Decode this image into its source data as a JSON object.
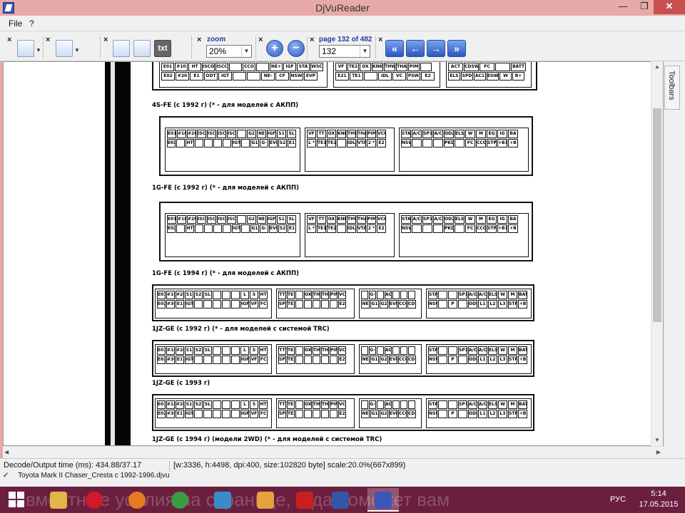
{
  "window": {
    "title": "DjVuReader",
    "minimize": "—",
    "maximize": "❐",
    "close": "✕"
  },
  "menu": {
    "file": "File",
    "help": "?"
  },
  "toolbar": {
    "zoom_label": "zoom",
    "zoom_value": "20%",
    "page_label": "page 132 of 482",
    "page_value": "132",
    "zoom_in": "+",
    "zoom_out": "−",
    "first": "«",
    "prev": "←",
    "next": "→",
    "last": "»",
    "close_mark": "×",
    "txt_label": "txt"
  },
  "side": {
    "toolbars_label": "Toolbars"
  },
  "document": {
    "captions": [
      "4S-FE (с 1992 г) (* - для моделей с АКПП)",
      "1G-FE (с 1992 г) (* - для моделей с АКПП)",
      "1G-FE (с 1994 г) (* - для моделей с АКПП)",
      "1JZ-GE (с 1992 г) (* - для моделей с системой TRC)",
      "1JZ-GE (с 1993 г)",
      "1JZ-GE (с 1994 г) (модели 2WD) (* - для моделей с системой TRC)"
    ],
    "connector_top_row": [
      [
        "E01",
        "#10",
        "HT",
        "ISCO",
        "ISCC",
        "",
        "CCO",
        "",
        "NE+",
        "IGF",
        "STA",
        "WSC"
      ],
      [
        "VF",
        "TE2",
        "OX",
        "KNK",
        "THW",
        "THA",
        "PIM",
        ""
      ],
      [
        "ACT",
        "CDSW",
        "FC",
        "",
        "BATT"
      ]
    ],
    "connector_top_row2": [
      [
        "E02",
        "#20",
        "E1",
        "ODT",
        "IGT",
        "",
        "",
        "NE-",
        "CF",
        "NSW",
        "EVP"
      ],
      [
        "E21",
        "TE1",
        "",
        "IDL",
        "VC",
        "PSW",
        "E2"
      ],
      [
        "ELS",
        "SPD",
        "AC1",
        "EGW",
        "W",
        "B+"
      ]
    ],
    "connectors_1g_a": [
      [
        "E01",
        "#10",
        "#20",
        "ISC 1",
        "ISC 2",
        "ISC 3",
        "ISC 4",
        "",
        "G2",
        "NE",
        "IGF",
        "S1 *",
        "SL *"
      ],
      [
        "E02",
        "",
        "HT",
        "",
        "",
        "",
        "",
        "IGT",
        "",
        "G1",
        "G-",
        "EVP",
        "S2 *",
        "E1"
      ],
      [
        "VF",
        "TT *",
        "OX",
        "KNK",
        "THW",
        "THA",
        "PIM",
        "VCC"
      ],
      [
        "L *",
        "TE1",
        "TE2",
        "",
        "IDL",
        "VTA",
        "2 *",
        "E2"
      ],
      [
        "STA",
        "A/C",
        "SP1",
        "A/C MG",
        "OD2 *",
        "ELS",
        "W",
        "M REL",
        "EG W",
        "IG SW",
        "BA TT"
      ],
      [
        "NSW *",
        "",
        "",
        "",
        "PKD *",
        "",
        "FC",
        "CCO",
        "STP",
        "+B1",
        "+B"
      ]
    ],
    "connectors_1jz": [
      [
        "E01",
        "#10",
        "#20",
        "S1",
        "S2",
        "SL",
        "",
        "",
        "",
        "L",
        "S",
        "HT"
      ],
      [
        "E02",
        "#30",
        "E1",
        "IGT",
        "",
        "",
        "",
        "",
        "",
        "IGF",
        "VF",
        "FC"
      ],
      [
        "TT",
        "TE1",
        "",
        "OX",
        "THA",
        "THW",
        "PIM",
        "VCC"
      ],
      [
        "SP2",
        "TE2",
        "",
        "",
        "",
        "",
        "",
        "E2"
      ],
      [
        "",
        "G-",
        "",
        "ACV",
        "",
        "",
        ""
      ],
      [
        "NE",
        "G1",
        "G2",
        "EVP",
        "CCO",
        "CDS"
      ],
      [
        "STA",
        "",
        "",
        "SP1",
        "A/C",
        "A/C",
        "ELS",
        "W",
        "M",
        "BATT"
      ],
      [
        "NSW",
        "",
        "P",
        "",
        "ODI",
        "L1",
        "L2",
        "L3",
        "STP",
        "+B"
      ]
    ]
  },
  "status": {
    "decode_time": "Decode/Output time (ms): 434.88/37.17",
    "page_info": "[w:3336, h:4498, dpi:400, size:102820 byte] scale:20.0%(667x899)",
    "file_tab": "Toyota Mark II Chaser_Cresta с 1992-1996.djvu"
  },
  "taskbar": {
    "ticker": "…вместные усилия на странице, и да поможет вам",
    "lang": "РУС",
    "time": "5:14",
    "date": "17.05.2015"
  },
  "colors": {
    "accent": "#2e5bc4",
    "window_frame": "#e8a9a9",
    "taskbar": "#6b1f3e",
    "close_button": "#c7504f"
  }
}
